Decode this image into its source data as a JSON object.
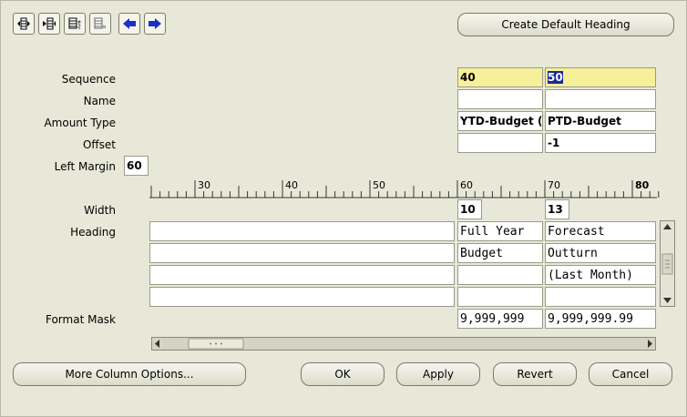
{
  "toolbar": {
    "icons": [
      "insert-column-icon",
      "delete-column-icon",
      "copy-column-icon",
      "paste-column-icon",
      "move-left-icon",
      "move-right-icon"
    ],
    "create_heading_label": "Create Default Heading"
  },
  "form": {
    "sequence_label": "Sequence",
    "name_label": "Name",
    "amount_type_label": "Amount Type",
    "offset_label": "Offset",
    "left_margin_label": "Left Margin",
    "left_margin_value": "60",
    "width_label": "Width",
    "heading_label": "Heading",
    "format_mask_label": "Format Mask"
  },
  "ruler": {
    "ticks": [
      "30",
      "40",
      "50",
      "60",
      "70",
      "80"
    ]
  },
  "columns": [
    {
      "sequence": "40",
      "name": "",
      "amount_type": "YTD-Budget (F",
      "offset": "",
      "width": "10",
      "heading": [
        "Full Year",
        "Budget",
        "",
        ""
      ],
      "format_mask": "9,999,999"
    },
    {
      "sequence": "50",
      "name": "",
      "amount_type": "PTD-Budget",
      "offset": "-1",
      "width": "13",
      "heading": [
        "Forecast",
        "Outturn",
        "(Last Month)",
        ""
      ],
      "format_mask": "9,999,999.99"
    }
  ],
  "buttons": {
    "more_options": "More Column Options...",
    "ok": "OK",
    "apply": "Apply",
    "revert": "Revert",
    "cancel": "Cancel"
  },
  "colors": {
    "background": "#e8e8d8",
    "highlight": "#f6f09a",
    "selection": "#1a2a9c",
    "arrow": "#1c2fcc"
  }
}
